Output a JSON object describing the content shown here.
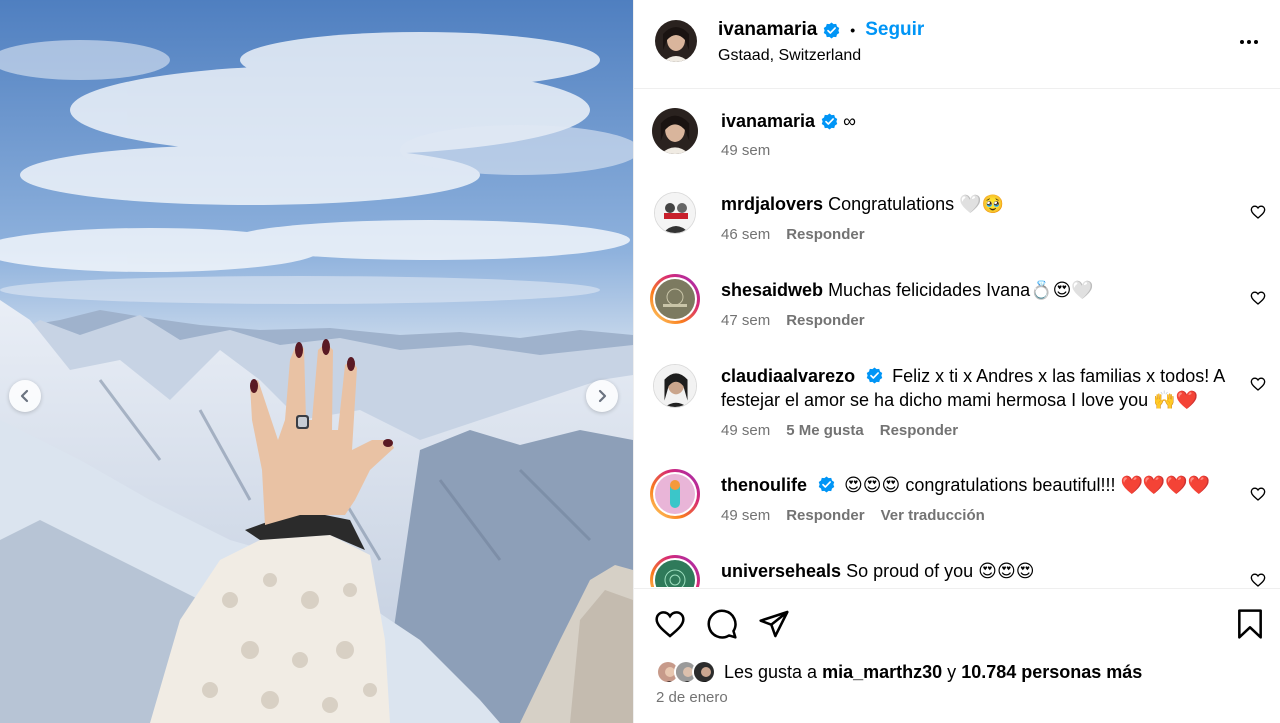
{
  "post": {
    "author": "ivanamaria",
    "follow_label": "Seguir",
    "location": "Gstaad, Switzerland",
    "caption_emoji": "∞",
    "caption_time": "49 sem"
  },
  "comments": [
    {
      "user": "mrdjalovers",
      "text": "Congratulations 🤍🥹",
      "time": "46 sem",
      "likes": "",
      "reply": "Responder",
      "translate": ""
    },
    {
      "user": "shesaidweb",
      "text": "Muchas felicidades Ivana💍😍🤍",
      "time": "47 sem",
      "likes": "",
      "reply": "Responder",
      "translate": ""
    },
    {
      "user": "claudiaalvarezo",
      "text": "Feliz x ti x Andres x las familias x todos! A festejar el amor se ha dicho mami hermosa I love you 🙌❤️",
      "time": "49 sem",
      "likes": "5 Me gusta",
      "reply": "Responder",
      "translate": ""
    },
    {
      "user": "thenoulife",
      "text": "😍😍😍 congratulations beautiful!!! ❤️❤️❤️❤️",
      "time": "49 sem",
      "likes": "",
      "reply": "Responder",
      "translate": "Ver traducción"
    },
    {
      "user": "universeheals",
      "text": "So proud of you 😍😍😍",
      "time": "",
      "likes": "",
      "reply": "",
      "translate": ""
    }
  ],
  "likes_line": {
    "prefix": "Les gusta a",
    "user": "mia_marthz30",
    "joiner": "y",
    "others": "10.784 personas más"
  },
  "date": "2 de enero",
  "colors": {
    "accent": "#0095f6",
    "verified": "#0095f6",
    "muted": "#737373"
  },
  "icons": [
    "chevron-left-icon",
    "chevron-right-icon",
    "verified-badge-icon",
    "more-options-icon",
    "heart-icon",
    "comment-icon",
    "share-icon",
    "bookmark-icon"
  ]
}
